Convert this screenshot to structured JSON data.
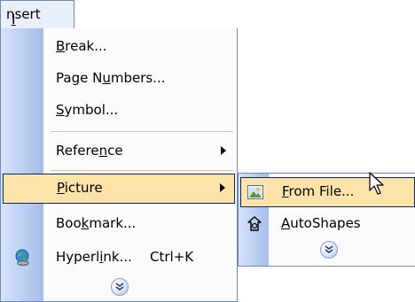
{
  "menubar": {
    "insert_label": "Insert"
  },
  "insert_menu": {
    "items": [
      {
        "label": "Break...",
        "mnemonic_index": 0
      },
      {
        "label": "Page Numbers...",
        "mnemonic_index": 6
      },
      {
        "label": "Symbol...",
        "mnemonic_index": 0
      },
      {
        "label": "Reference",
        "mnemonic_index": 6,
        "has_submenu": true
      },
      {
        "label": "Picture",
        "mnemonic_index": 0,
        "has_submenu": true,
        "highlighted": true
      },
      {
        "label": "Bookmark...",
        "mnemonic_index": 3
      },
      {
        "label": "Hyperlink...",
        "mnemonic_index": 6,
        "shortcut": "Ctrl+K",
        "icon": "hyperlink-globe-icon"
      }
    ],
    "expand_icon": "chevron-double-down-icon"
  },
  "picture_submenu": {
    "items": [
      {
        "label": "From File...",
        "mnemonic_index": 0,
        "highlighted": true,
        "icon": "picture-from-file-icon"
      },
      {
        "label": "AutoShapes",
        "mnemonic_index": 0,
        "icon": "autoshapes-icon"
      }
    ],
    "expand_icon": "chevron-double-down-icon"
  },
  "colors": {
    "highlight_fill": "#fce3a8",
    "highlight_border": "#0a246a",
    "gutter": "#b7ccf0",
    "menu_border": "#6f8ab8"
  }
}
